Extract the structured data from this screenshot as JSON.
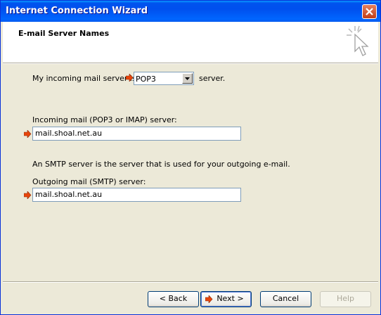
{
  "window": {
    "title": "Internet Connection Wizard"
  },
  "header": {
    "title": "E-mail Server Names"
  },
  "incoming_type": {
    "prefix": "My incoming mail server is a",
    "selected": "POP3",
    "suffix": "server."
  },
  "incoming": {
    "label": "Incoming mail (POP3 or IMAP) server:",
    "value": "mail.shoal.net.au"
  },
  "smtp_note": "An SMTP server is the server that is used for your outgoing e-mail.",
  "outgoing": {
    "label": "Outgoing mail (SMTP) server:",
    "value": "mail.shoal.net.au"
  },
  "buttons": {
    "back": "< Back",
    "next": "Next >",
    "cancel": "Cancel",
    "help": "Help"
  },
  "icons": {
    "close": "close-icon",
    "wizard": "wizard-cursor-icon",
    "pointer": "red-arrow-icon"
  },
  "colors": {
    "titlebar": "#0053ee",
    "pointer": "#e8450b",
    "close": "#c13f18"
  }
}
